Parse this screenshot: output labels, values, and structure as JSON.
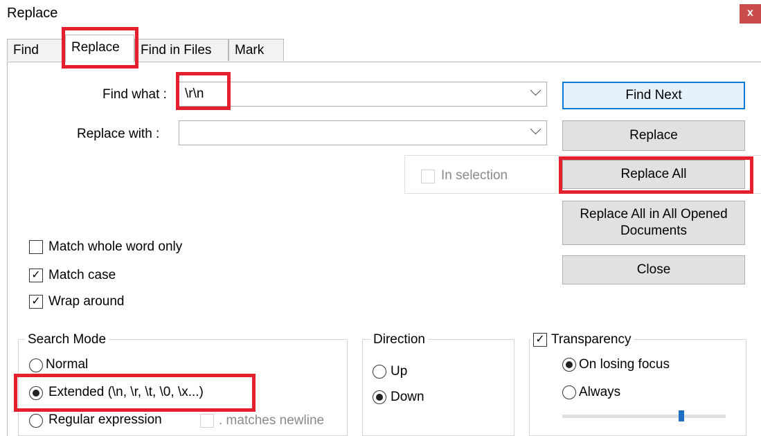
{
  "window": {
    "title": "Replace",
    "close_glyph": "x"
  },
  "tabs": [
    {
      "label": "Find"
    },
    {
      "label": "Replace"
    },
    {
      "label": "Find in Files"
    },
    {
      "label": "Mark"
    }
  ],
  "find_what": {
    "label": "Find what :",
    "value": "\\r\\n"
  },
  "replace_with": {
    "label": "Replace with :",
    "value": ""
  },
  "buttons": {
    "find_next": "Find Next",
    "replace": "Replace",
    "replace_all": "Replace All",
    "replace_all_opened": "Replace All in All Opened Documents",
    "close": "Close"
  },
  "in_selection": {
    "label": "In selection",
    "checked": false
  },
  "options": [
    {
      "label": "Match whole word only",
      "checked": false
    },
    {
      "label": "Match case",
      "checked": true
    },
    {
      "label": "Wrap around",
      "checked": true
    }
  ],
  "search_mode": {
    "title": "Search Mode",
    "options": [
      {
        "label": "Normal",
        "selected": false
      },
      {
        "label": "Extended (\\n, \\r, \\t, \\0, \\x...)",
        "selected": true
      },
      {
        "label": "Regular expression",
        "selected": false
      }
    ],
    "matches_newline": ". matches newline"
  },
  "direction": {
    "title": "Direction",
    "options": [
      {
        "label": "Up",
        "selected": false
      },
      {
        "label": "Down",
        "selected": true
      }
    ]
  },
  "transparency": {
    "label": "Transparency",
    "checked": true,
    "options": [
      {
        "label": "On losing focus",
        "selected": true
      },
      {
        "label": "Always",
        "selected": false
      }
    ],
    "slider_value": 0.8
  },
  "colors": {
    "highlight": "#e4202e",
    "default_button_border": "#0a7bd6"
  }
}
